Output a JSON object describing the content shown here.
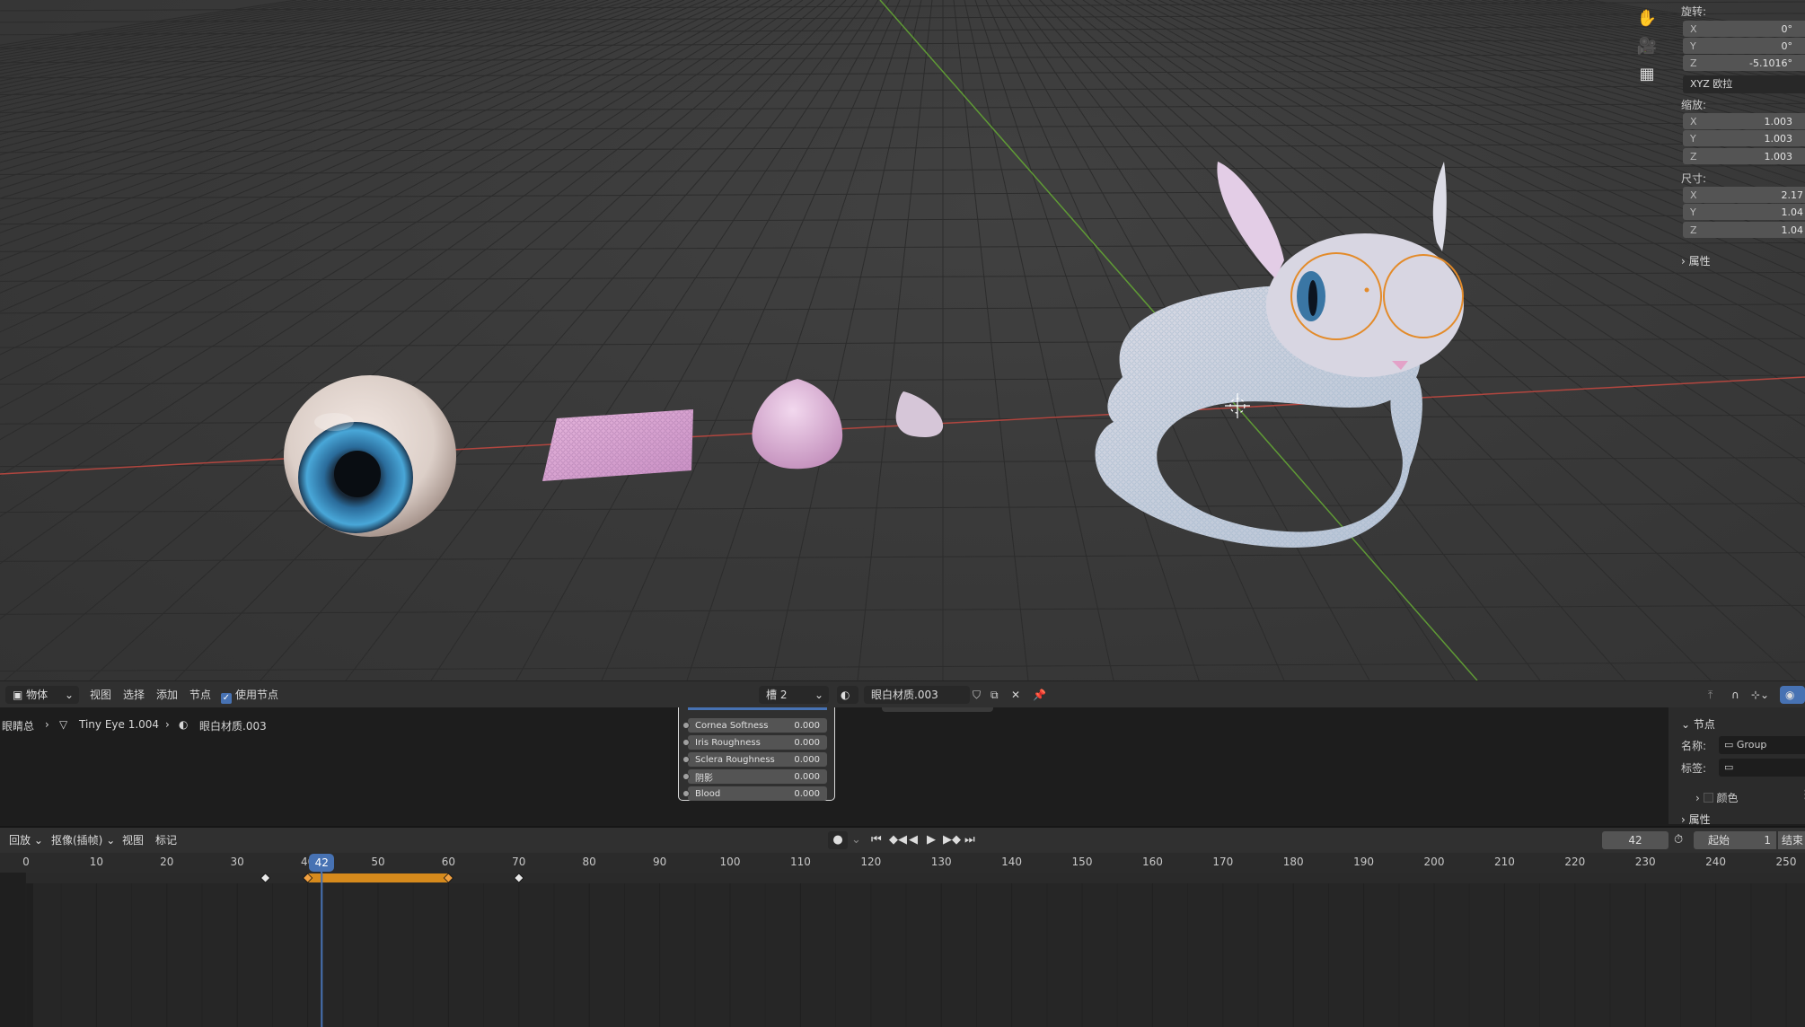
{
  "viewport": {
    "nav_icons": [
      "hand-icon",
      "camera-icon",
      "grid-icon"
    ],
    "npanel": {
      "rotation_label": "旋转:",
      "rotation": [
        {
          "axis": "X",
          "value": "0°"
        },
        {
          "axis": "Y",
          "value": "0°"
        },
        {
          "axis": "Z",
          "value": "-5.1016°"
        }
      ],
      "rotation_mode": "XYZ 欧拉",
      "scale_label": "缩放:",
      "scale": [
        {
          "axis": "X",
          "value": "1.003"
        },
        {
          "axis": "Y",
          "value": "1.003"
        },
        {
          "axis": "Z",
          "value": "1.003"
        }
      ],
      "dimensions_label": "尺寸:",
      "dimensions": [
        {
          "axis": "X",
          "value": "2.17"
        },
        {
          "axis": "Y",
          "value": "1.04"
        },
        {
          "axis": "Z",
          "value": "1.04"
        }
      ],
      "properties_label": "属性"
    }
  },
  "node_editor": {
    "header": {
      "mode": "物体",
      "menus": [
        "视图",
        "选择",
        "添加",
        "节点"
      ],
      "use_nodes_label": "使用节点",
      "slot": "槽 2",
      "material": "眼白材质.003"
    },
    "breadcrumb": {
      "root": "眼睛总",
      "object": "Tiny Eye 1.004",
      "material": "眼白材质.003"
    },
    "node_sockets": [
      {
        "label": "Cornea Softness",
        "value": "0.000"
      },
      {
        "label": "Iris Roughness",
        "value": "0.000"
      },
      {
        "label": "Sclera Roughness",
        "value": "0.000"
      },
      {
        "label": "阴影",
        "value": "0.000"
      },
      {
        "label": "Blood",
        "value": "0.000"
      }
    ],
    "sidebar": {
      "section": "节点",
      "name_label": "名称:",
      "name_value": "Group",
      "label_label": "标签:",
      "color_label": "颜色",
      "properties_label": "属性"
    }
  },
  "timeline": {
    "menus": [
      "回放",
      "抠像(插帧)",
      "视图",
      "标记"
    ],
    "current_frame": "42",
    "start_label": "起始",
    "start_value": "1",
    "end_label": "结束",
    "ticks": [
      "0",
      "10",
      "20",
      "30",
      "40",
      "50",
      "60",
      "70",
      "80",
      "90",
      "100",
      "110",
      "120",
      "130",
      "140",
      "150",
      "160",
      "170",
      "180",
      "190",
      "200",
      "210",
      "220",
      "230",
      "240",
      "250"
    ],
    "keyframes": [
      34,
      40,
      60,
      70
    ],
    "hold_range": [
      40,
      60
    ]
  },
  "colors": {
    "accent": "#4772b3",
    "keyframe_hold": "#d68a1c",
    "x_axis": "#c9473f",
    "y_axis": "#6fa23a"
  }
}
